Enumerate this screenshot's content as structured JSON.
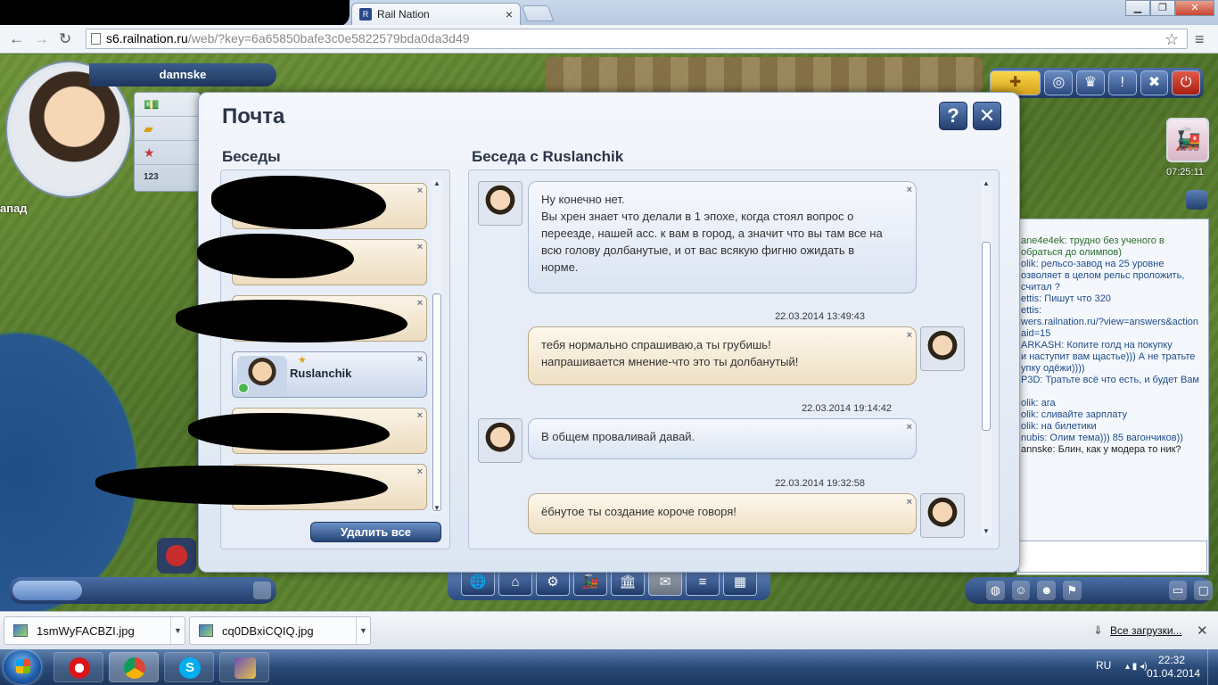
{
  "browser": {
    "tab_title": "Rail Nation",
    "tab_close": "×",
    "url_host": "s6.railnation.ru",
    "url_path": "/web/?key=6a65850bafe3c0e5822579bda0da3d49",
    "window_controls": {
      "minimize": "▁",
      "maximize": "❐",
      "close": "✕"
    }
  },
  "hud": {
    "player_name": "dannske",
    "region_label": "апад",
    "clock": "07:25:11",
    "resources": [
      {
        "icon": "money-icon",
        "glyph": "💵"
      },
      {
        "icon": "gold-icon",
        "glyph": "▰"
      },
      {
        "icon": "prestige-icon",
        "glyph": "★"
      },
      {
        "icon": "ranking-icon",
        "glyph": "123"
      }
    ]
  },
  "chat": {
    "lines": [
      {
        "text": "ane4e4ek: трудно без ученого в",
        "color": "g"
      },
      {
        "text": "обраться до олимпов)",
        "color": "g"
      },
      {
        "text": "olik: рельсо-завод на 25 уровне",
        "color": "b"
      },
      {
        "text": "озволяет в целом рельс проложить,",
        "color": "b"
      },
      {
        "text": "считал ?",
        "color": "b"
      },
      {
        "text": "ettis: Пишут что 320",
        "color": "b"
      },
      {
        "text": "ettis:",
        "color": "b"
      },
      {
        "text": "wers.railnation.ru/?view=answers&action",
        "color": "b"
      },
      {
        "text": "aid=15",
        "color": "b"
      },
      {
        "text": "ARKASH: Копите голд на покупку",
        "color": "b"
      },
      {
        "text": "и наступит вам щастье))) А не тратьте",
        "color": "b"
      },
      {
        "text": "упку одёжи))))",
        "color": "b"
      },
      {
        "text": "P3D: Тратьте всё что есть, и будет Вам",
        "color": "b"
      },
      {
        "text": "",
        "color": "b"
      },
      {
        "text": "olik: ага",
        "color": "b"
      },
      {
        "text": "olik: сливайте зарплату",
        "color": "b"
      },
      {
        "text": "olik: на билетики",
        "color": "b"
      },
      {
        "text": "nubis: Олим тема))) 85 вагончиков))",
        "color": "b"
      },
      {
        "text": "annske: Блин, как у модера то ник?",
        "color": "k"
      }
    ]
  },
  "mail": {
    "title": "Почта",
    "help_label": "?",
    "close_label": "✕",
    "conversations_title": "Беседы",
    "thread_title": "Беседа с Ruslanchik",
    "delete_all_label": "Удалить все",
    "conversation_x": "×",
    "active_conversation_name": "Ruslanchik",
    "messages": [
      {
        "direction": "in",
        "date": "",
        "lines": [
          "Ну конечно нет.",
          "Вы хрен знает что делали в 1 эпохе, когда стоял вопрос о",
          "переезде, нашей асс. к вам в город, а значит что вы там все на",
          "всю голову долбанутые, и от вас всякую фигню ожидать в",
          "норме."
        ]
      },
      {
        "direction": "out",
        "date": "22.03.2014 13:49:43",
        "lines": [
          "тебя нормально спрашиваю,а ты грубишь!",
          "напрашивается мнение-что это ты долбанутый!"
        ]
      },
      {
        "direction": "in",
        "date": "22.03.2014 19:14:42",
        "lines": [
          "В общем проваливай давай."
        ]
      },
      {
        "direction": "out",
        "date": "22.03.2014 19:32:58",
        "lines": [
          "ёбнутое ты создание короче говоря!"
        ]
      }
    ]
  },
  "bottom_toolbar": [
    "🌐",
    "⌂",
    "⚙",
    "🚂",
    "🏛",
    "✉",
    "≡",
    "▦"
  ],
  "downloads": {
    "items": [
      "1smWyFACBZI.jpg",
      "cq0DBxiCQIQ.jpg"
    ],
    "all_label": "Все загрузки...",
    "close": "✕"
  },
  "taskbar": {
    "lang": "RU",
    "time": "22:32",
    "date": "01.04.2014"
  }
}
